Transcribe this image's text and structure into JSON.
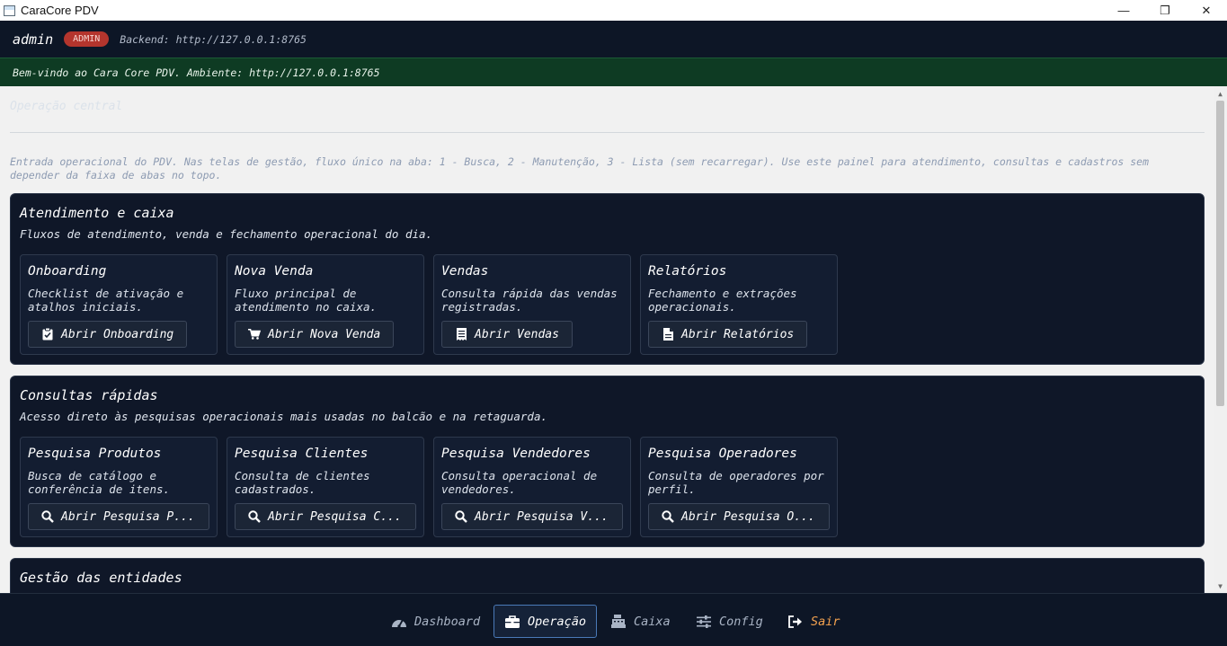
{
  "window": {
    "title": "CaraCore PDV",
    "controls": [
      "—",
      "❐",
      "✕"
    ]
  },
  "topbar": {
    "user": "admin",
    "role_badge": "ADMIN",
    "backend": "Backend: http://127.0.0.1:8765"
  },
  "welcome": "Bem-vindo ao Cara Core PDV. Ambiente: http://127.0.0.1:8765",
  "content": {
    "title": "Operação central",
    "intro": "Entrada operacional do PDV. Nas telas de gestão, fluxo único na aba: 1 - Busca, 2 - Manutenção, 3 - Lista (sem recarregar). Use este painel para atendimento, consultas e cadastros sem depender da faixa de abas no topo.",
    "panels": [
      {
        "title": "Atendimento e caixa",
        "subtitle": "Fluxos de atendimento, venda e fechamento operacional do dia.",
        "cards": [
          {
            "title": "Onboarding",
            "desc": "Checklist de ativação e atalhos iniciais.",
            "button": "Abrir Onboarding",
            "icon": "clipboard-check-icon"
          },
          {
            "title": "Nova Venda",
            "desc": "Fluxo principal de atendimento no caixa.",
            "button": "Abrir Nova Venda",
            "icon": "cart-icon"
          },
          {
            "title": "Vendas",
            "desc": "Consulta rápida das vendas registradas.",
            "button": "Abrir Vendas",
            "icon": "receipt-icon"
          },
          {
            "title": "Relatórios",
            "desc": "Fechamento e extrações operacionais.",
            "button": "Abrir Relatórios",
            "icon": "document-icon"
          }
        ]
      },
      {
        "title": "Consultas rápidas",
        "subtitle": "Acesso direto às pesquisas operacionais mais usadas no balcão e na retaguarda.",
        "cards": [
          {
            "title": "Pesquisa Produtos",
            "desc": "Busca de catálogo e conferência de itens.",
            "button": "Abrir Pesquisa P...",
            "icon": "search-icon"
          },
          {
            "title": "Pesquisa Clientes",
            "desc": "Consulta de clientes cadastrados.",
            "button": "Abrir Pesquisa C...",
            "icon": "search-icon"
          },
          {
            "title": "Pesquisa Vendedores",
            "desc": "Consulta operacional de vendedores.",
            "button": "Abrir Pesquisa V...",
            "icon": "search-icon"
          },
          {
            "title": "Pesquisa Operadores",
            "desc": "Consulta de operadores por perfil.",
            "button": "Abrir Pesquisa O...",
            "icon": "search-icon"
          }
        ]
      },
      {
        "title": "Gestão das entidades"
      }
    ]
  },
  "bottom_nav": [
    {
      "label": "Dashboard",
      "icon": "gauge-icon"
    },
    {
      "label": "Operação",
      "icon": "briefcase-icon",
      "active": true
    },
    {
      "label": "Caixa",
      "icon": "cash-register-icon"
    },
    {
      "label": "Config",
      "icon": "sliders-icon"
    },
    {
      "label": "Sair",
      "icon": "logout-icon",
      "color": "#f4a24f"
    }
  ]
}
